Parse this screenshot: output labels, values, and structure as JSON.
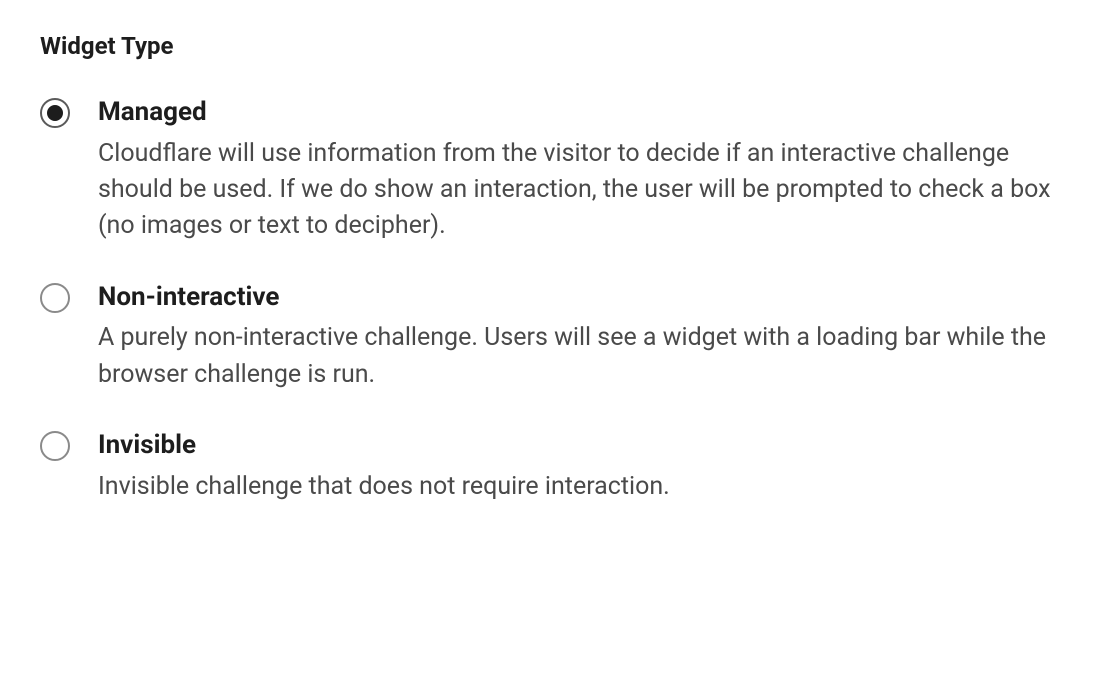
{
  "section": {
    "title": "Widget Type"
  },
  "options": [
    {
      "label": "Managed",
      "description": "Cloudflare will use information from the visitor to decide if an interactive challenge should be used. If we do show an interaction, the user will be prompted to check a box (no images or text to decipher).",
      "selected": true
    },
    {
      "label": "Non-interactive",
      "description": "A purely non-interactive challenge. Users will see a widget with a loading bar while the browser challenge is run.",
      "selected": false
    },
    {
      "label": "Invisible",
      "description": "Invisible challenge that does not require interaction.",
      "selected": false
    }
  ]
}
